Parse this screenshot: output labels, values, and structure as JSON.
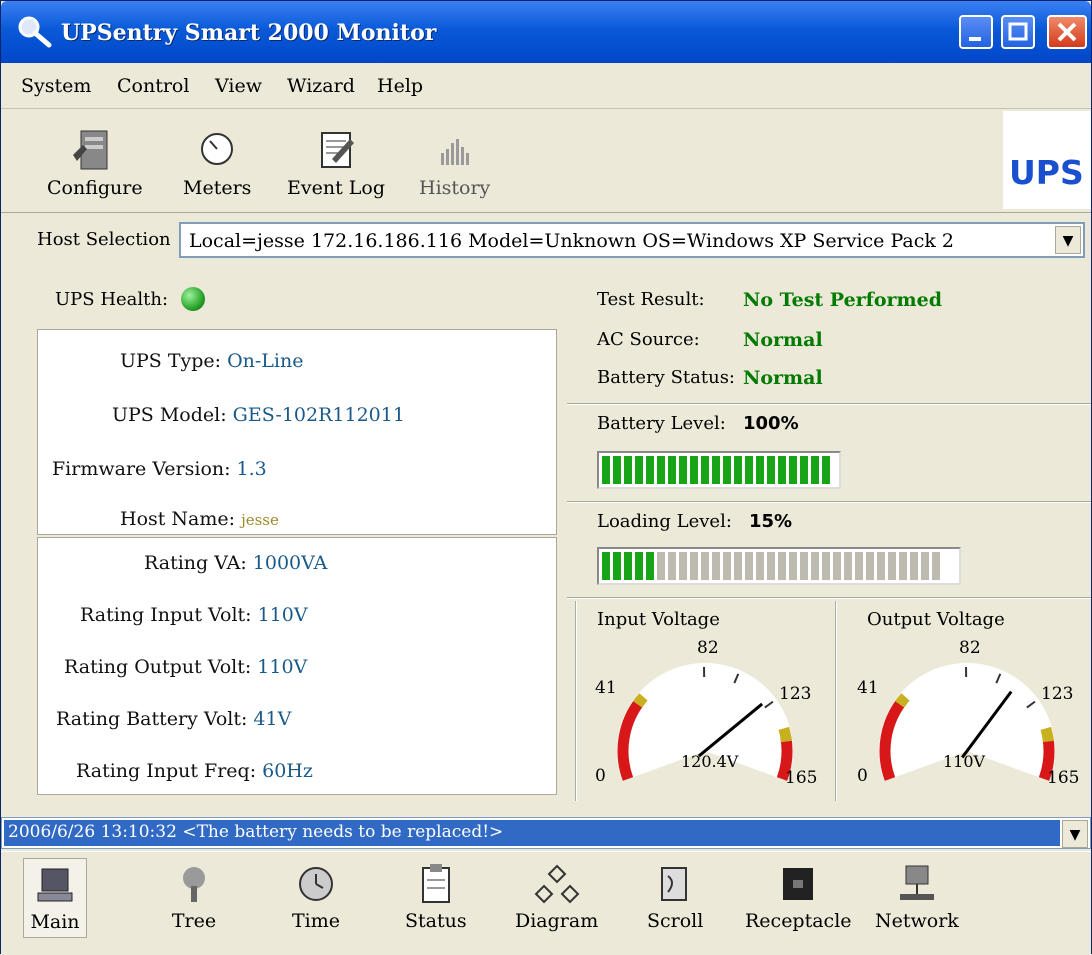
{
  "window": {
    "title": "UPSentry Smart 2000 Monitor"
  },
  "menu": [
    "System",
    "Control",
    "View",
    "Wizard",
    "Help"
  ],
  "toolbar": {
    "configure": "Configure",
    "meters": "Meters",
    "event_log": "Event Log",
    "history": "History",
    "logo": "UPS"
  },
  "host": {
    "label": "Host Selection",
    "value": "Local=jesse 172.16.186.116  Model=Unknown  OS=Windows XP Service Pack 2"
  },
  "health": {
    "label": "UPS Health:",
    "status_color": "#2aa52a"
  },
  "info": {
    "ups_type_k": "UPS Type:",
    "ups_type_v": "On-Line",
    "ups_model_k": "UPS Model:",
    "ups_model_v": "GES-102R112011",
    "firmware_k": "Firmware Version:",
    "firmware_v": "1.3",
    "hostname_k": "Host Name:",
    "hostname_v": "jesse"
  },
  "ratings": {
    "va_k": "Rating VA:",
    "va_v": "1000VA",
    "in_k": "Rating Input Volt:",
    "in_v": "110V",
    "out_k": "Rating Output Volt:",
    "out_v": "110V",
    "bat_k": "Rating Battery Volt:",
    "bat_v": "41V",
    "freq_k": "Rating Input Freq:",
    "freq_v": "60Hz"
  },
  "status": {
    "test_k": "Test Result:",
    "test_v": "No Test Performed",
    "ac_k": "AC Source:",
    "ac_v": "Normal",
    "bat_k": "Battery Status:",
    "bat_v": "Normal"
  },
  "battery": {
    "label": "Battery Level:",
    "value_text": "100%",
    "level": 1.0
  },
  "loading": {
    "label": "Loading Level:",
    "value_text": "15%",
    "level": 0.15
  },
  "input_gauge": {
    "label": "Input Voltage",
    "min": "0",
    "t41": "41",
    "t82": "82",
    "t123": "123",
    "max": "165",
    "reading": "120.4V",
    "value": 120.4
  },
  "output_gauge": {
    "label": "Output Voltage",
    "min": "0",
    "t41": "41",
    "t82": "82",
    "t123": "123",
    "max": "165",
    "reading": "110V",
    "value": 110
  },
  "message": "2006/6/26 13:10:32  <The battery needs to be replaced!>",
  "bottom_tabs": [
    "Main",
    "Tree",
    "Time",
    "Status",
    "Diagram",
    "Scroll",
    "Receptacle",
    "Network"
  ]
}
